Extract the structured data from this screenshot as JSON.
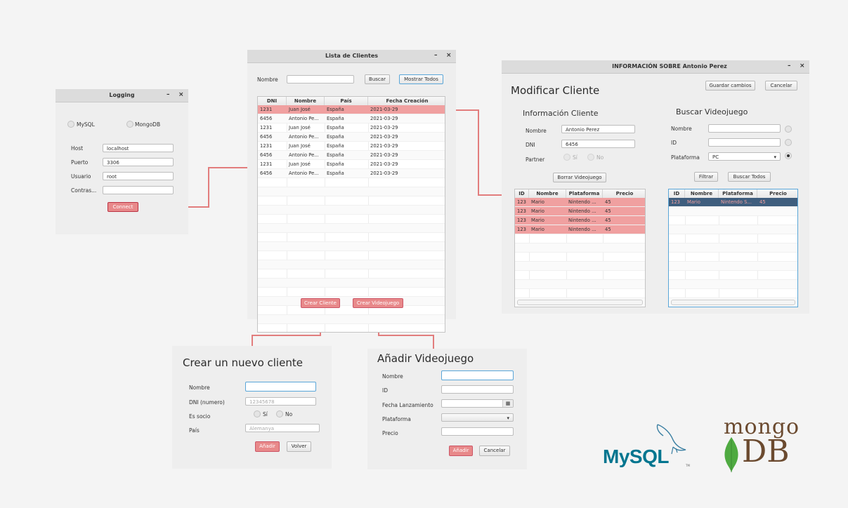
{
  "logging": {
    "title": "Logging",
    "minimize": "–",
    "close": "×",
    "mysql_label": "MySQL",
    "mongodb_label": "MongoDB",
    "host_label": "Host",
    "host_value": "localhost",
    "port_label": "Puerto",
    "port_value": "3306",
    "user_label": "Usuario",
    "user_value": "root",
    "pass_label": "Contras...",
    "pass_value": "",
    "connect_label": "Connect"
  },
  "clientes": {
    "title": "Lista de Clientes",
    "minimize": "–",
    "close": "×",
    "nombre_label": "Nombre",
    "nombre_value": "",
    "buscar_label": "Buscar",
    "mostrar_label": "Mostrar Todos",
    "columns": [
      "DNI",
      "Nombre",
      "País",
      "Fecha Creación"
    ],
    "rows": [
      [
        "1231",
        "Juan José",
        "España",
        "2021-03-29"
      ],
      [
        "6456",
        "Antonio Pe...",
        "España",
        "2021-03-29"
      ],
      [
        "1231",
        "Juan José",
        "España",
        "2021-03-29"
      ],
      [
        "6456",
        "Antonio Pe...",
        "España",
        "2021-03-29"
      ],
      [
        "1231",
        "Juan José",
        "España",
        "2021-03-29"
      ],
      [
        "6456",
        "Antonio Pe...",
        "España",
        "2021-03-29"
      ],
      [
        "1231",
        "Juan José",
        "España",
        "2021-03-29"
      ],
      [
        "6456",
        "Antonio Pe...",
        "España",
        "2021-03-29"
      ]
    ],
    "crear_cliente_label": "Crear Cliente",
    "crear_videojuego_label": "Crear Videojuego"
  },
  "info": {
    "title": "INFORMACIÓN SOBRE Antonio Perez",
    "minimize": "–",
    "close": "×",
    "heading": "Modificar Cliente",
    "guardar_label": "Guardar cambios",
    "cancelar_label": "Cancelar",
    "info_heading": "Información Cliente",
    "nombre_label": "Nombre",
    "nombre_value": "Antonio Perez",
    "dni_label": "DNI",
    "dni_value": "6456",
    "partner_label": "Partner",
    "si_label": "Sí",
    "no_label": "No",
    "borrar_label": "Borrar Videojuego",
    "buscar_heading": "Buscar Videojuego",
    "b_nombre_label": "Nombre",
    "b_id_label": "ID",
    "b_plataforma_label": "Plataforma",
    "b_plataforma_value": "PC",
    "filtrar_label": "Filtrar",
    "buscar_todos_label": "Buscar Todos",
    "columns": [
      "ID",
      "Nombre",
      "Plataforma",
      "Precio"
    ],
    "left_rows": [
      [
        "123",
        "Mario",
        "Nintendo ...",
        "45"
      ],
      [
        "123",
        "Mario",
        "Nintendo ...",
        "45"
      ],
      [
        "123",
        "Mario",
        "Nintendo ...",
        "45"
      ],
      [
        "123",
        "Mario",
        "Nintendo ...",
        "45"
      ]
    ],
    "right_rows": [
      [
        "123",
        "Mario",
        "Nintendo S...",
        "45"
      ]
    ]
  },
  "nuevo_cliente": {
    "heading": "Crear un nuevo cliente",
    "nombre_label": "Nombre",
    "nombre_value": "",
    "dni_label": "DNI (numero)",
    "dni_placeholder": "12345678",
    "socio_label": "Es socio",
    "si_label": "Sí",
    "no_label": "No",
    "pais_label": "País",
    "pais_placeholder": "Alemanya",
    "anadir_label": "Añadir",
    "volver_label": "Volver"
  },
  "videojuego": {
    "heading": "Añadir Videojuego",
    "nombre_label": "Nombre",
    "id_label": "ID",
    "fecha_label": "Fecha Lanzamiento",
    "plataforma_label": "Plataforma",
    "precio_label": "Precio",
    "anadir_label": "Añadir",
    "cancelar_label": "Cancelar"
  },
  "logos": {
    "mysql_text": "MySQL",
    "mysql_tm": "TM",
    "mongo_top": "mongo",
    "mongo_bottom": "DB"
  },
  "colors": {
    "accent_red": "#e8898a",
    "row_pink": "#f0a0a0",
    "focus_blue": "#5aa6d8",
    "mongo_green": "#4faa41",
    "mongo_brown": "#6b4a2f",
    "mysql_blue": "#00758f",
    "mysql_orange": "#f29111"
  }
}
